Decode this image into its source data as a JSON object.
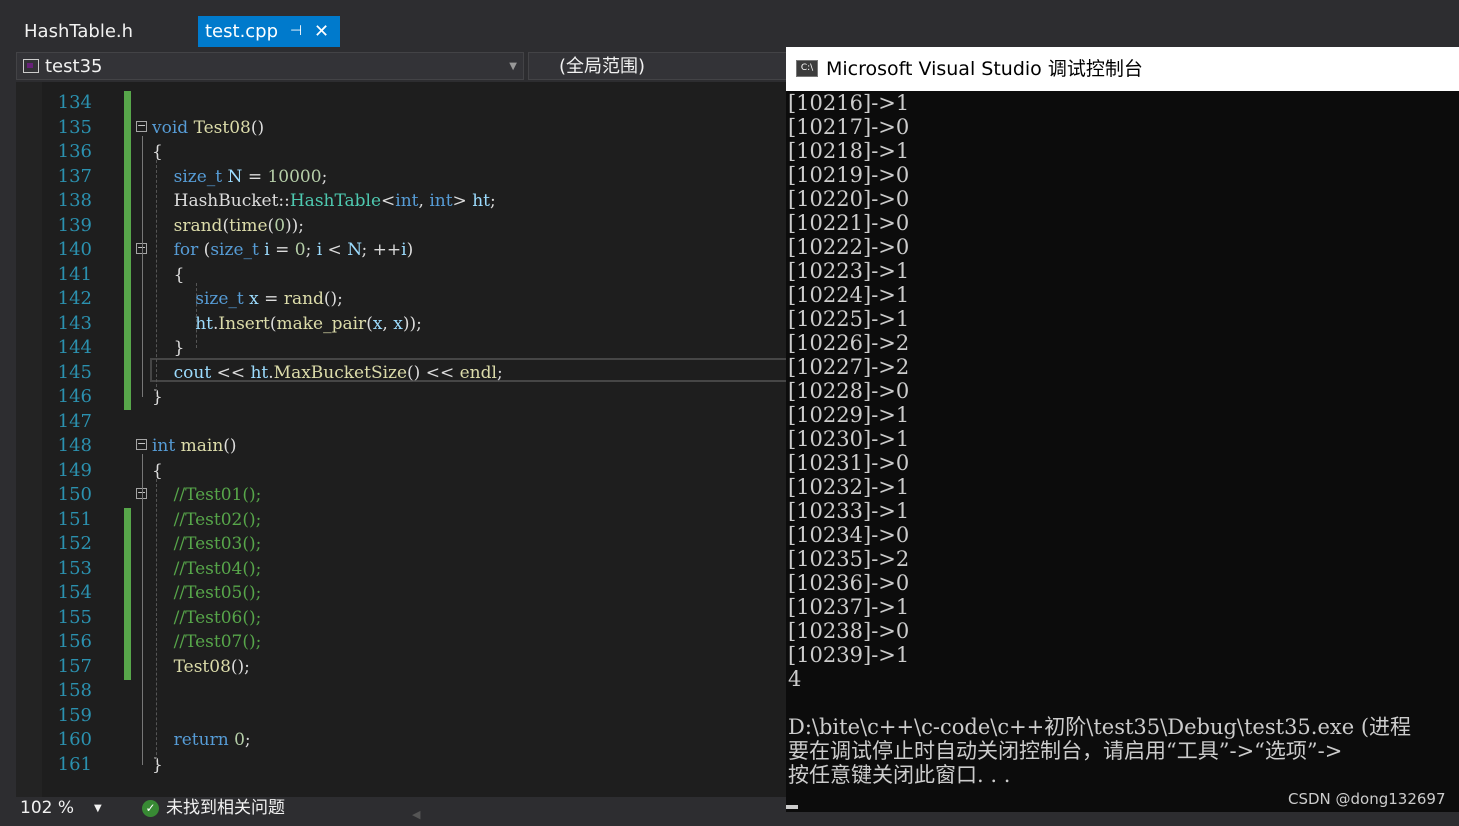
{
  "tabs": [
    {
      "label": "HashTable.h",
      "active": false
    },
    {
      "label": "test.cpp",
      "active": true,
      "pin_glyph": "⊣",
      "close_glyph": "✕"
    }
  ],
  "navbar": {
    "project": "test35",
    "scope": "(全局范围)"
  },
  "editor": {
    "lines": [
      {
        "n": "134",
        "html": ""
      },
      {
        "n": "135",
        "html": "<span class=\"kw\">void</span> <span class=\"fn\">Test08</span>()"
      },
      {
        "n": "136",
        "html": "{"
      },
      {
        "n": "137",
        "html": "    <span class=\"kw\">size_t</span> <span class=\"vr\">N</span> = <span class=\"num\">10000</span>;"
      },
      {
        "n": "138",
        "html": "    HashBucket::<span class=\"ty\">HashTable</span><<span class=\"kw\">int</span>, <span class=\"kw\">int</span>> <span class=\"vr\">ht</span>;"
      },
      {
        "n": "139",
        "html": "    <span class=\"fn\">srand</span>(<span class=\"fn\">time</span>(<span class=\"num\">0</span>));"
      },
      {
        "n": "140",
        "html": "    <span class=\"kw\">for</span> (<span class=\"kw\">size_t</span> <span class=\"vr\">i</span> = <span class=\"num\">0</span>; <span class=\"vr\">i</span> < <span class=\"vr\">N</span>; ++<span class=\"vr\">i</span>)"
      },
      {
        "n": "141",
        "html": "    {"
      },
      {
        "n": "142",
        "html": "        <span class=\"kw\">size_t</span> <span class=\"vr\">x</span> = <span class=\"fn\">rand</span>();"
      },
      {
        "n": "143",
        "html": "        <span class=\"vr\">ht</span>.<span class=\"fn\">Insert</span>(<span class=\"fn\">make_pair</span>(<span class=\"vr\">x</span>, <span class=\"vr\">x</span>));"
      },
      {
        "n": "144",
        "html": "    }"
      },
      {
        "n": "145",
        "html": "    <span class=\"vr\">cout</span> << <span class=\"vr\">ht</span>.<span class=\"fn\">MaxBucketSize</span>() << <span class=\"fn\">endl</span>;"
      },
      {
        "n": "146",
        "html": "}"
      },
      {
        "n": "147",
        "html": ""
      },
      {
        "n": "148",
        "html": "<span class=\"kw\">int</span> <span class=\"fn\">main</span>()"
      },
      {
        "n": "149",
        "html": "{"
      },
      {
        "n": "150",
        "html": "    <span class=\"cm\">//Test01();</span>"
      },
      {
        "n": "151",
        "html": "    <span class=\"cm\">//Test02();</span>"
      },
      {
        "n": "152",
        "html": "    <span class=\"cm\">//Test03();</span>"
      },
      {
        "n": "153",
        "html": "    <span class=\"cm\">//Test04();</span>"
      },
      {
        "n": "154",
        "html": "    <span class=\"cm\">//Test05();</span>"
      },
      {
        "n": "155",
        "html": "    <span class=\"cm\">//Test06();</span>"
      },
      {
        "n": "156",
        "html": "    <span class=\"cm\">//Test07();</span>"
      },
      {
        "n": "157",
        "html": "    <span class=\"fn\">Test08</span>();"
      },
      {
        "n": "158",
        "html": ""
      },
      {
        "n": "159",
        "html": ""
      },
      {
        "n": "160",
        "html": "    <span class=\"kw\">return</span> <span class=\"num\">0</span>;"
      },
      {
        "n": "161",
        "html": "}"
      }
    ],
    "fold_lines": [
      "135",
      "140",
      "148",
      "150"
    ],
    "changed_lines": [
      "134",
      "135",
      "136",
      "137",
      "138",
      "139",
      "140",
      "141",
      "142",
      "143",
      "144",
      "145",
      "146",
      "151",
      "152",
      "153",
      "154",
      "155",
      "156",
      "157"
    ]
  },
  "statusbar": {
    "zoom": "102 %",
    "issues": "未找到相关问题",
    "ok_color": "#388a34"
  },
  "console": {
    "title": "Microsoft Visual Studio 调试控制台",
    "icon_text": "C:\\",
    "lines": [
      "[10216]->1",
      "[10217]->0",
      "[10218]->1",
      "[10219]->0",
      "[10220]->0",
      "[10221]->0",
      "[10222]->0",
      "[10223]->1",
      "[10224]->1",
      "[10225]->1",
      "[10226]->2",
      "[10227]->2",
      "[10228]->0",
      "[10229]->1",
      "[10230]->1",
      "[10231]->0",
      "[10232]->1",
      "[10233]->1",
      "[10234]->0",
      "[10235]->2",
      "[10236]->0",
      "[10237]->1",
      "[10238]->0",
      "[10239]->1",
      "4",
      "",
      "D:\\bite\\c++\\c-code\\c++初阶\\test35\\Debug\\test35.exe (进程",
      "要在调试停止时自动关闭控制台，请启用“工具”->“选项”->",
      "按任意键关闭此窗口. . ."
    ]
  },
  "watermark": "CSDN @dong132697",
  "colors": {
    "accent_tab": "#007acc",
    "editor_bg": "#1e1e1e",
    "console_bg": "#0c0c0c",
    "change_bar": "#57a64a"
  }
}
